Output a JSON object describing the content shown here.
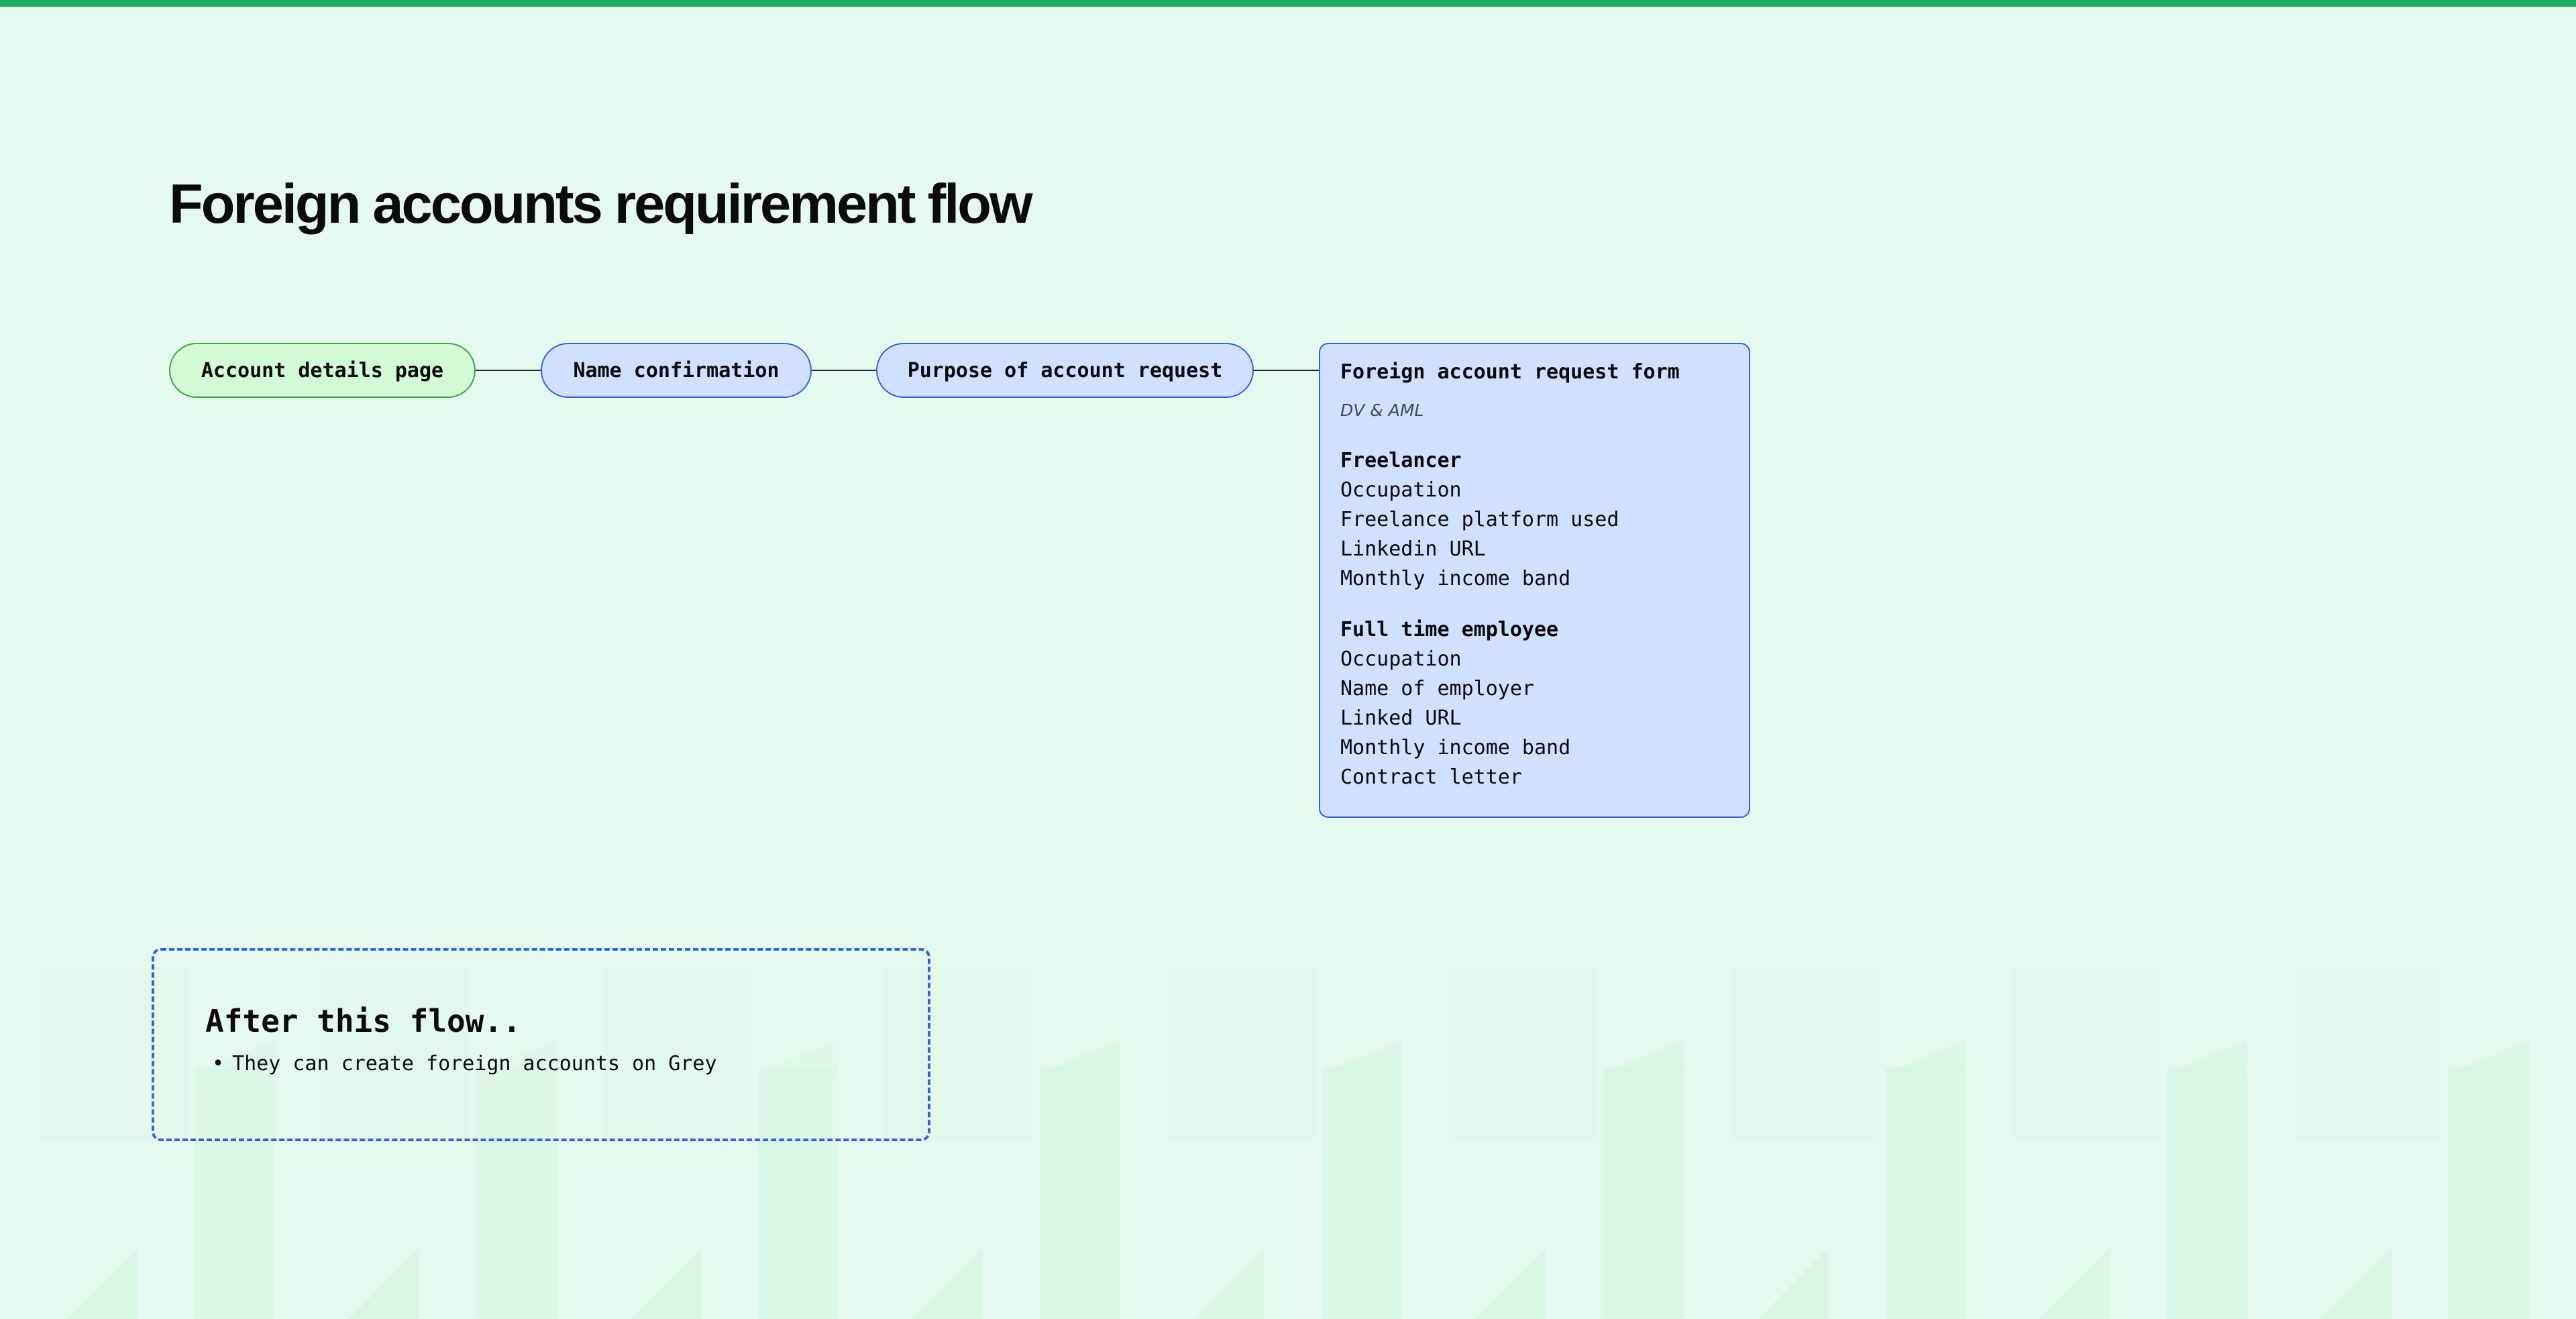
{
  "title": "Foreign accounts requirement flow",
  "colors": {
    "top_bar": "#1aae5c",
    "background": "#e5f9ee",
    "node_blue_fill": "#d1e0ff",
    "node_blue_border": "#2d63e3",
    "node_green_fill": "#d2fad5",
    "node_green_border": "#3fa53f",
    "connector": "#1f2a30"
  },
  "flow": {
    "nodes": [
      {
        "label": "Account details page"
      },
      {
        "label": "Name confirmation"
      },
      {
        "label": "Purpose of account request"
      }
    ],
    "form": {
      "title": "Foreign account request form",
      "subtitle": "DV & AML",
      "sections": [
        {
          "title": "Freelancer",
          "items": [
            "Occupation",
            "Freelance platform used",
            "Linkedin URL",
            "Monthly income band"
          ]
        },
        {
          "title": "Full time employee",
          "items": [
            "Occupation",
            "Name of employer",
            "Linked URL",
            "Monthly income band",
            "Contract letter"
          ]
        }
      ]
    }
  },
  "after": {
    "title": "After this flow..",
    "items": [
      "They can create foreign accounts on Grey"
    ]
  }
}
